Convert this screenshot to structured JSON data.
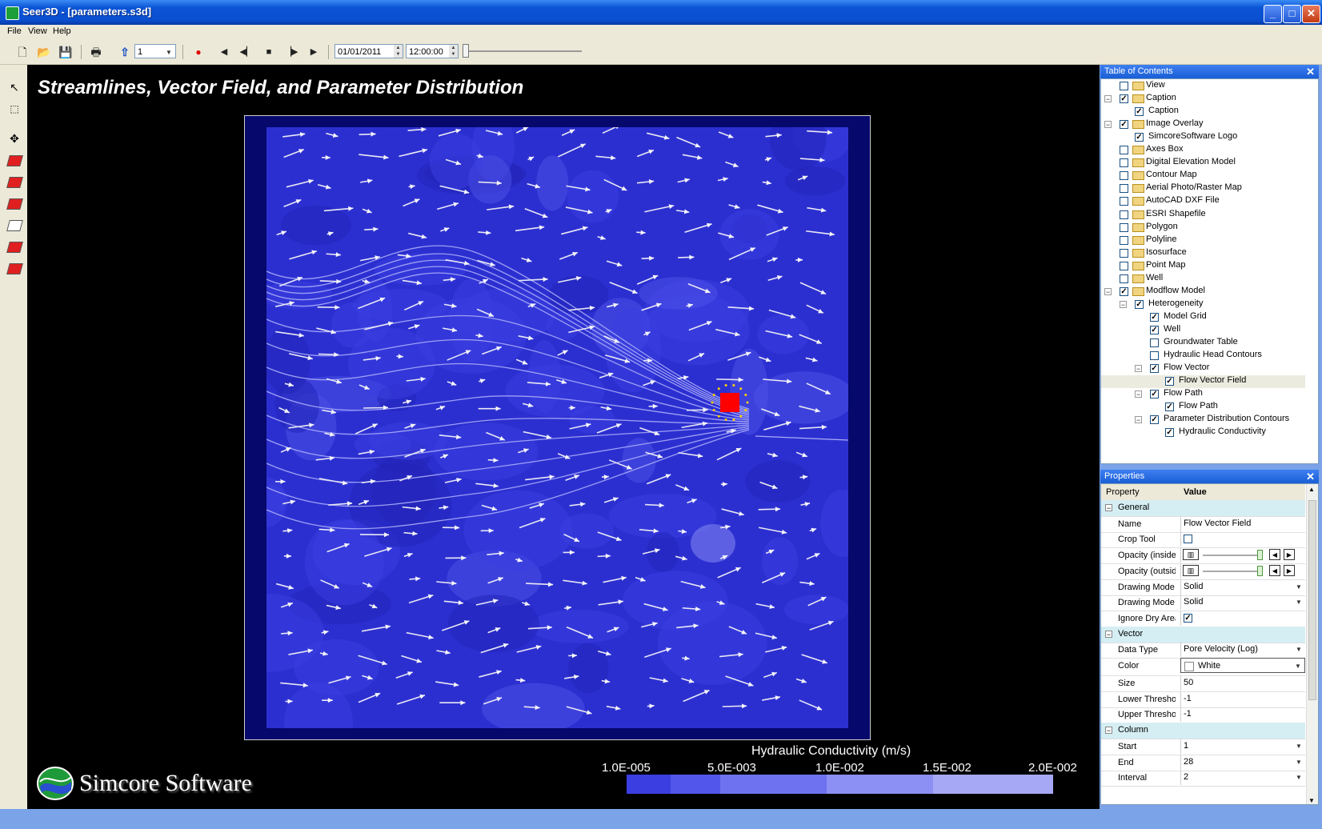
{
  "window": {
    "title": "Seer3D - [parameters.s3d]",
    "minimize_glyph": "_",
    "maximize_glyph": "□",
    "close_glyph": "✕"
  },
  "menu": [
    "File",
    "View",
    "Help"
  ],
  "toolbar": {
    "step_value": "1",
    "date_value": "01/01/2011",
    "time_value": "12:00:00",
    "timeline_position": 0.0
  },
  "viewport": {
    "caption": "Streamlines, Vector Field, and Parameter Distribution",
    "legend": {
      "title": "Hydraulic Conductivity (m/s)",
      "ticks": [
        "1.0E-005",
        "5.0E-003",
        "1.0E-002",
        "1.5E-002",
        "2.0E-002"
      ],
      "colors": [
        "#3b3ee0",
        "#5356ea",
        "#6e72f0",
        "#8c8ff4",
        "#a6a8f6"
      ]
    },
    "logo_text": "Simcore Software",
    "well_color": "#ff0000",
    "field_color": "#2c2fd0"
  },
  "toc": {
    "title": "Table of Contents",
    "close_glyph": "✕",
    "items": [
      {
        "label": "View",
        "checked": false,
        "expander": "",
        "folder": true
      },
      {
        "label": "Caption",
        "checked": true,
        "expander": "−",
        "folder": true
      },
      {
        "label": "Caption",
        "checked": true,
        "expander": "",
        "folder": false
      },
      {
        "label": "Image Overlay",
        "checked": true,
        "expander": "−",
        "folder": true
      },
      {
        "label": "SimcoreSoftware Logo",
        "checked": true,
        "expander": "",
        "folder": false
      },
      {
        "label": "Axes Box",
        "checked": false,
        "expander": "",
        "folder": true
      },
      {
        "label": "Digital Elevation Model",
        "checked": false,
        "expander": "",
        "folder": true
      },
      {
        "label": "Contour Map",
        "checked": false,
        "expander": "",
        "folder": true
      },
      {
        "label": "Aerial Photo/Raster Map",
        "checked": false,
        "expander": "",
        "folder": true
      },
      {
        "label": "AutoCAD DXF File",
        "checked": false,
        "expander": "",
        "folder": true
      },
      {
        "label": "ESRI Shapefile",
        "checked": false,
        "expander": "",
        "folder": true
      },
      {
        "label": "Polygon",
        "checked": false,
        "expander": "",
        "folder": true
      },
      {
        "label": "Polyline",
        "checked": false,
        "expander": "",
        "folder": true
      },
      {
        "label": "Isosurface",
        "checked": false,
        "expander": "",
        "folder": true
      },
      {
        "label": "Point Map",
        "checked": false,
        "expander": "",
        "folder": true
      },
      {
        "label": "Well",
        "checked": false,
        "expander": "",
        "folder": true
      },
      {
        "label": "Modflow Model",
        "checked": true,
        "expander": "−",
        "folder": true
      },
      {
        "label": "Heterogeneity",
        "checked": true,
        "expander": "−",
        "folder": false
      },
      {
        "label": "Model Grid",
        "checked": true,
        "expander": "",
        "folder": false
      },
      {
        "label": "Well",
        "checked": true,
        "expander": "",
        "folder": false
      },
      {
        "label": "Groundwater Table",
        "checked": false,
        "expander": "",
        "folder": false
      },
      {
        "label": "Hydraulic Head Contours",
        "checked": false,
        "expander": "",
        "folder": false
      },
      {
        "label": "Flow Vector",
        "checked": true,
        "expander": "−",
        "folder": false
      },
      {
        "label": "Flow Vector Field",
        "checked": true,
        "expander": "",
        "folder": false,
        "selected": true
      },
      {
        "label": "Flow Path",
        "checked": true,
        "expander": "−",
        "folder": false
      },
      {
        "label": "Flow Path",
        "checked": true,
        "expander": "",
        "folder": false
      },
      {
        "label": "Parameter Distribution Contours",
        "checked": true,
        "expander": "−",
        "folder": false
      },
      {
        "label": "Hydraulic Conductivity",
        "checked": true,
        "expander": "",
        "folder": false
      }
    ]
  },
  "properties": {
    "title": "Properties",
    "close_glyph": "✕",
    "header_property": "Property",
    "header_value": "Value",
    "rows": [
      {
        "category": "General"
      },
      {
        "name": "Name",
        "value": "Flow Vector Field"
      },
      {
        "name": "Crop Tool",
        "checkbox": false
      },
      {
        "name": "Opacity (inside c",
        "slider": true
      },
      {
        "name": "Opacity (outside",
        "slider": true
      },
      {
        "name": "Drawing Mode (",
        "value": "Solid",
        "dropdown": true
      },
      {
        "name": "Drawing Mode (",
        "value": "Solid",
        "dropdown": true
      },
      {
        "name": "Ignore Dry Areas",
        "checkbox": true
      },
      {
        "category": "Vector"
      },
      {
        "name": "Data Type",
        "value": "Pore Velocity (Log)",
        "dropdown": true
      },
      {
        "name": "Color",
        "value": "White",
        "dropdown": true,
        "swatch": "#ffffff"
      },
      {
        "name": "Size",
        "value": "50"
      },
      {
        "name": "Lower Threshold",
        "value": "-1"
      },
      {
        "name": "Upper Threshold",
        "value": "-1"
      },
      {
        "category": "Column"
      },
      {
        "name": "Start",
        "value": "1",
        "dropdown": true
      },
      {
        "name": "End",
        "value": "28",
        "dropdown": true
      },
      {
        "name": "Interval",
        "value": "2",
        "dropdown": true
      }
    ]
  }
}
